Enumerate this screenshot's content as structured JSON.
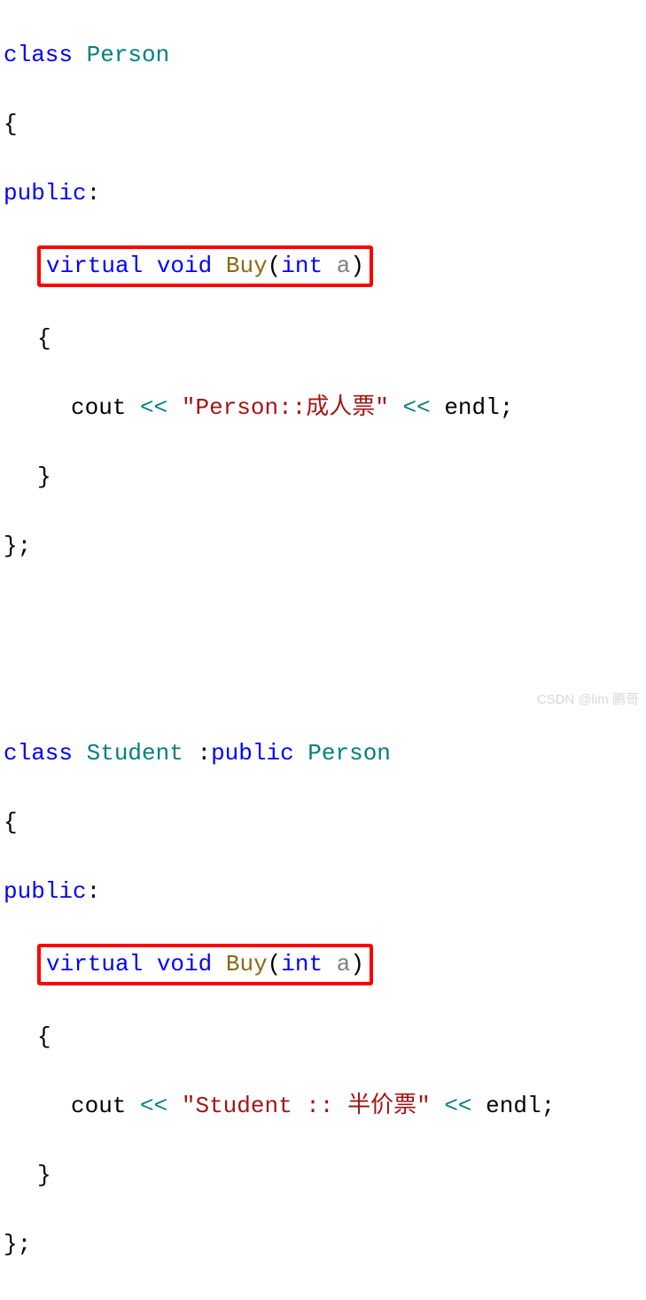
{
  "person": {
    "class_kw": "class",
    "name": "Person",
    "open_brace": "{",
    "public_kw": "public",
    "colon": ":",
    "virtual_kw": "virtual",
    "void_kw": "void",
    "fn_name": "Buy",
    "open_paren": "(",
    "int_kw": "int",
    "param": "a",
    "close_paren": ")",
    "body_open": "{",
    "cout": "cout",
    "lshift": "<<",
    "str": "\"Person::成人票\"",
    "endl": "endl",
    "semi": ";",
    "body_close": "}",
    "close_brace": "};"
  },
  "student": {
    "class_kw": "class",
    "name": "Student",
    "colon_inh": " :",
    "public_inh": "public",
    "base": "Person",
    "open_brace": "{",
    "public_kw": "public",
    "colon": ":",
    "virtual_kw": "virtual",
    "void_kw": "void",
    "fn_name": "Buy",
    "open_paren": "(",
    "int_kw": "int",
    "param": "a",
    "close_paren": ")",
    "body_open": "{",
    "cout": "cout",
    "lshift": "<<",
    "str": "\"Student :: 半价票\"",
    "endl": "endl",
    "semi": ";",
    "body_close": "}",
    "close_brace": "};"
  },
  "watermark": "CSDN @lim 鹏哥"
}
